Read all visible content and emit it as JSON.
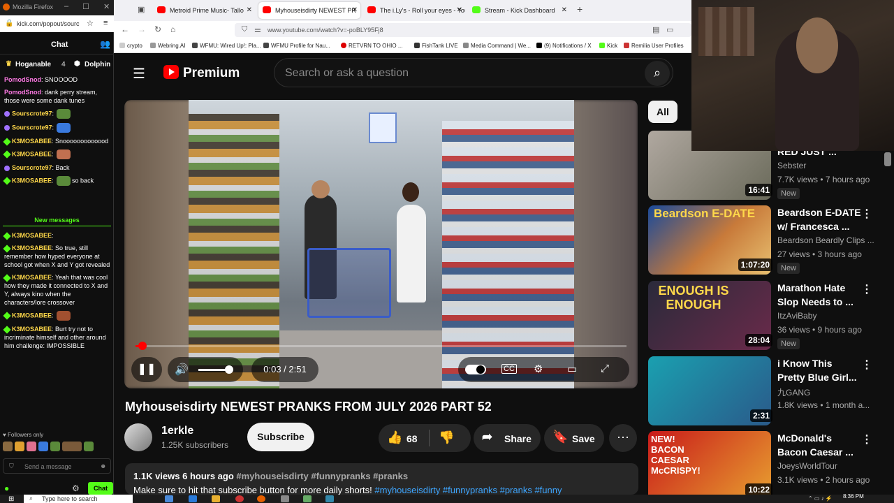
{
  "chat_window": {
    "title": "Mozilla Firefox",
    "url": "kick.com/popout/sourc",
    "header": "Chat",
    "pinned": {
      "user1": "Hoganable",
      "count": "4",
      "user2": "Dolphin"
    },
    "messages": [
      {
        "user": "PomodSnod",
        "text": "SNOOOOD",
        "color": "#ff7ae5"
      },
      {
        "user": "PomodSnod",
        "text": "dank perry stream, those were some dank tunes",
        "color": "#ff7ae5"
      },
      {
        "user": "Sourscrote97",
        "text": "",
        "color": "#ffd84a"
      },
      {
        "user": "Sourscrote97",
        "text": "",
        "color": "#ffd84a"
      },
      {
        "user": "K3MOSABEE",
        "text": "Snooooooooooood",
        "color": "#ffd84a"
      },
      {
        "user": "K3MOSABEE",
        "text": "",
        "color": "#ffd84a"
      },
      {
        "user": "Sourscrote97",
        "text": "Back",
        "color": "#ffd84a"
      },
      {
        "user": "K3MOSABEE",
        "text": "so back",
        "color": "#ffd84a"
      }
    ],
    "new_messages_label": "New messages",
    "messages_after": [
      {
        "user": "K3MOSABEE",
        "text": "",
        "color": "#ffd84a"
      },
      {
        "user": "K3MOSABEE",
        "text": "So true, still remember how hyped everyone at school got when X and Y got revealed",
        "color": "#ffd84a"
      },
      {
        "user": "K3MOSABEE",
        "text": "Yeah that was cool how they made it connected to X and Y, always kino when the characters/lore crossover",
        "color": "#ffd84a"
      },
      {
        "user": "K3MOSABEE",
        "text": "",
        "color": "#ffd84a"
      },
      {
        "user": "K3MOSABEE",
        "text": "Burt try not to incriminate himself and other around him challenge: IMPOSSIBLE",
        "color": "#ffd84a"
      }
    ],
    "followers_only": "Followers only",
    "send_placeholder": "Send a message",
    "chat_button": "Chat"
  },
  "tabs": [
    {
      "label": "Metroid Prime Music- Tallo",
      "color": "#ff0000"
    },
    {
      "label": "Myhouseisdirty NEWEST PR",
      "color": "#ff0000",
      "active": true
    },
    {
      "label": "The i.Ly's - Roll your eyes - You",
      "color": "#ff0000"
    },
    {
      "label": "Stream - Kick Dashboard",
      "color": "#53fc18"
    }
  ],
  "address": "www.youtube.com/watch?v=-poBLY95Fj8",
  "bookmarks": [
    "crypto",
    "Webring.AI",
    "WFMU: Wired Up!: Pla...",
    "WFMU Profile for Nau...",
    "RETVRN TO OHIO ...",
    "FishTank LIVE",
    "Media Command | We...",
    "(9) Notifications / X",
    "Kick",
    "Remilia User Profiles"
  ],
  "youtube": {
    "brand": "Premium",
    "search_placeholder": "Search or ask a question",
    "player": {
      "time": "0:03 / 2:51",
      "progress": 0.018
    },
    "video_title": "Myhouseisdirty NEWEST PRANKS FROM JULY 2026 PART 52",
    "channel": "1erkle",
    "subscribers": "1.25K subscribers",
    "subscribe_label": "Subscribe",
    "likes": "68",
    "share_label": "Share",
    "save_label": "Save",
    "description": {
      "meta": "1.1K views  6 hours ago",
      "tags": "#myhouseisdirty #funnypranks #pranks",
      "line2_text": "Make sure to hit that subscribe button for more daily shorts! ",
      "line2_tags": "#myhouseisdirty #funnypranks #pranks #funny"
    },
    "chip_all": "All",
    "recommendations": [
      {
        "title": "RED JUST ...",
        "channel": "Sebster",
        "meta": "7.7K views • 7 hours ago",
        "badge": "New",
        "duration": "16:41",
        "thumb": "linear-gradient(135deg,#b0a8a0,#6a6a5a)"
      },
      {
        "title": "Beardson E-DATE w/ Francesca ...",
        "channel": "Beardson Beardly Clips ...",
        "meta": "27 views • 3 hours ago",
        "badge": "New",
        "duration": "1:07:20",
        "thumb": "linear-gradient(135deg,#1a4a9a,#c87a3a 55%,#e8c070)",
        "thumb_text": "Beardson E-DATE"
      },
      {
        "title": "Marathon Hate Slop Needs to ...",
        "channel": "ItzAviBaby",
        "meta": "36 views • 9 hours ago",
        "badge": "New",
        "duration": "28:04",
        "thumb": "linear-gradient(135deg,#2a2a3a,#6a2a4a)",
        "thumb_text": "ENOUGH IS ENOUGH"
      },
      {
        "title": "i Know This Pretty Blue Girl...",
        "channel": "九GANG",
        "meta": "1.8K views • 1 month a...",
        "badge": "",
        "duration": "2:31",
        "thumb": "linear-gradient(135deg,#1aa0b0,#2a5a8a)"
      },
      {
        "title": "McDonald's Bacon Caesar ...",
        "channel": "JoeysWorldTour",
        "meta": "3.1K views • 2 hours ago",
        "badge": "",
        "duration": "10:22",
        "thumb": "linear-gradient(135deg,#c81a1a,#e8a030)",
        "thumb_text": "NEW! BACON CAESAR McCRISPY!"
      }
    ]
  },
  "taskbar": {
    "search_placeholder": "Type here to search",
    "clock": "8:36 PM"
  }
}
